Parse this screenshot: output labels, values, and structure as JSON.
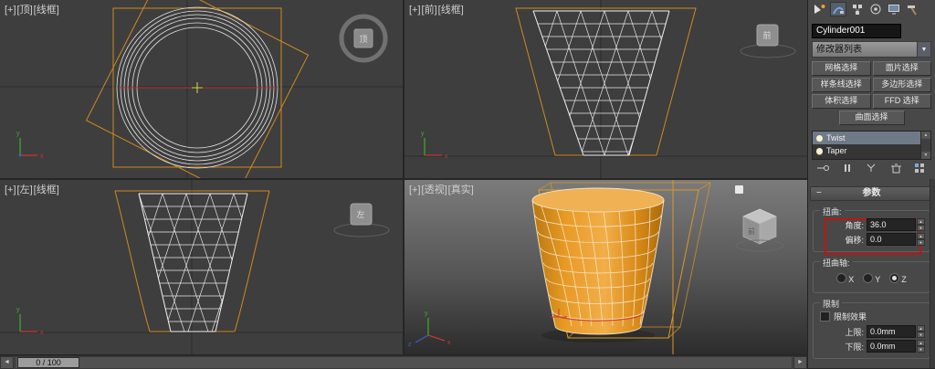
{
  "viewports": {
    "top": {
      "plus": "[+]",
      "view": "[顶]",
      "shading": "[线框]",
      "cube": "顶"
    },
    "front": {
      "plus": "[+]",
      "view": "[前]",
      "shading": "[线框]",
      "cube": "前"
    },
    "left": {
      "plus": "[+]",
      "view": "[左]",
      "shading": "[线框]",
      "cube": "左"
    },
    "persp": {
      "plus": "[+]",
      "view": "[透视]",
      "shading": "[真实]",
      "cube": "前"
    }
  },
  "timeline": {
    "handle": "0 / 100"
  },
  "panel": {
    "object_name": "Cylinder001",
    "modifier_list": "修改器列表",
    "sel_buttons": [
      "网格选择",
      "面片选择",
      "样条线选择",
      "多边形选择",
      "体积选择",
      "FFD 选择",
      "曲面选择"
    ],
    "stack": [
      {
        "name": "Twist"
      },
      {
        "name": "Taper"
      }
    ],
    "rollout_title": "参数",
    "twist": {
      "group": "扭曲:",
      "angle_label": "角度:",
      "angle": "36.0",
      "bias_label": "偏移:",
      "bias": "0.0"
    },
    "axis": {
      "group": "扭曲轴:",
      "x": "X",
      "y": "Y",
      "z": "Z"
    },
    "limits": {
      "group": "限制",
      "effect": "限制效果",
      "upper_label": "上限:",
      "upper": "0.0mm",
      "lower_label": "下限:",
      "lower": "0.0mm"
    }
  }
}
